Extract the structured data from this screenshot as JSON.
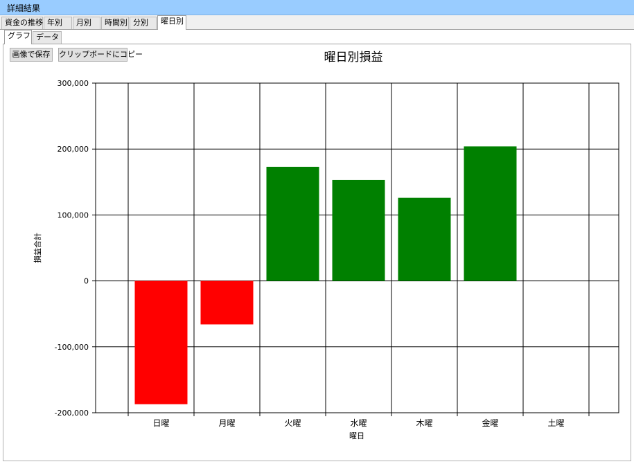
{
  "window": {
    "title": "詳細結果"
  },
  "tabs_main": [
    {
      "label": "資金の推移",
      "active": false
    },
    {
      "label": "年別",
      "active": false
    },
    {
      "label": "月別",
      "active": false
    },
    {
      "label": "時間別",
      "active": false
    },
    {
      "label": "分別",
      "active": false
    },
    {
      "label": "曜日別",
      "active": true
    }
  ],
  "tabs_sub": [
    {
      "label": "グラフ",
      "active": true
    },
    {
      "label": "データ",
      "active": false
    }
  ],
  "toolbar": {
    "save_image_label": "画像で保存",
    "copy_clipboard_label": "クリップボードにコピー"
  },
  "chart_data": {
    "type": "bar",
    "title": "曜日別損益",
    "xlabel": "曜日",
    "ylabel": "損益合計",
    "categories": [
      "日曜",
      "月曜",
      "火曜",
      "水曜",
      "木曜",
      "金曜",
      "土曜"
    ],
    "values": [
      -187000,
      -66000,
      173000,
      153000,
      126000,
      204000,
      0
    ],
    "ylim": [
      -200000,
      300000
    ],
    "yticks": [
      "300,000",
      "200,000",
      "100,000",
      "0",
      "-100,000",
      "-200,000"
    ],
    "ytick_values": [
      300000,
      200000,
      100000,
      0,
      -100000,
      -200000
    ],
    "grid": true,
    "positive_color": "#008000",
    "negative_color": "#ff0000"
  }
}
